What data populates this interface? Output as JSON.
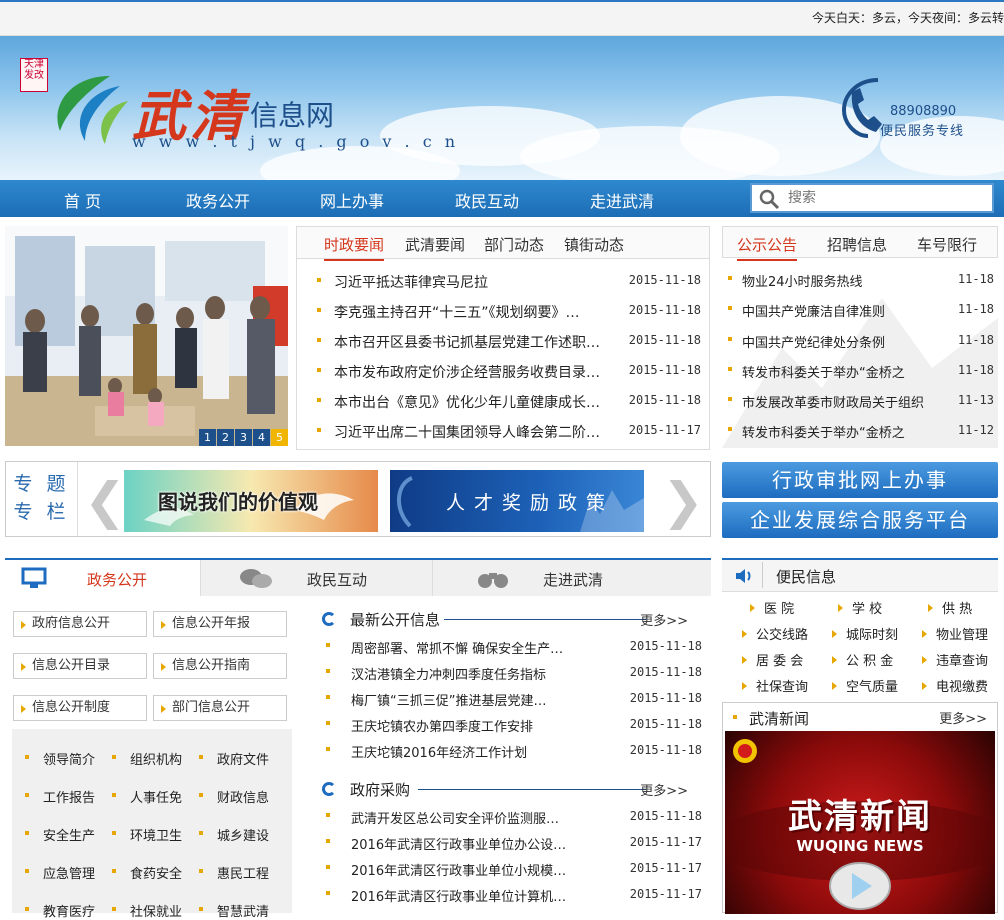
{
  "weather": "今天白天：多云，今天夜间：多云转",
  "header": {
    "emblem_text": "天津发改",
    "logo_title": "武清",
    "logo_sub": "信息网",
    "logo_url": "w w w . t j w q . g o v . c n",
    "hotline_number": "88908890",
    "hotline_text": "便民服务专线"
  },
  "nav": {
    "items": [
      "首 页",
      "政务公开",
      "网上办事",
      "政民互动",
      "走进武清"
    ],
    "search_placeholder": "搜索"
  },
  "slideshow": {
    "pages": [
      "1",
      "2",
      "3",
      "4",
      "5"
    ],
    "active_page": "5"
  },
  "news": {
    "tabs": [
      "时政要闻",
      "武清要闻",
      "部门动态",
      "镇街动态"
    ],
    "items": [
      {
        "title": "习近平抵达菲律宾马尼拉",
        "date": "2015-11-18"
      },
      {
        "title": "李克强主持召开“十三五”《规划纲要》…",
        "date": "2015-11-18"
      },
      {
        "title": "本市召开区县委书记抓基层党建工作述职…",
        "date": "2015-11-18"
      },
      {
        "title": "本市发布政府定价涉企经营服务收费目录…",
        "date": "2015-11-18"
      },
      {
        "title": "本市出台《意见》优化少年儿童健康成长…",
        "date": "2015-11-18"
      },
      {
        "title": "习近平出席二十国集团领导人峰会第二阶…",
        "date": "2015-11-17"
      }
    ]
  },
  "notice": {
    "tabs": [
      "公示公告",
      "招聘信息",
      "车号限行"
    ],
    "items": [
      {
        "title": "物业24小时服务热线",
        "date": "11-18"
      },
      {
        "title": "中国共产党廉洁自律准则",
        "date": "11-18"
      },
      {
        "title": "中国共产党纪律处分条例",
        "date": "11-18"
      },
      {
        "title": "转发市科委关于举办“金桥之",
        "date": "11-18"
      },
      {
        "title": "市发展改革委市财政局关于组织",
        "date": "11-13"
      },
      {
        "title": "转发市科委关于举办“金桥之",
        "date": "11-12"
      }
    ]
  },
  "topics": {
    "label_line1": "专 题",
    "label_line2": "专 栏",
    "banner1": "图说我们的价值观",
    "banner2": "人才奖励政策"
  },
  "big_buttons": [
    "行政审批网上办事",
    "企业发展综合服务平台"
  ],
  "lower_tabs": [
    "政务公开",
    "政民互动",
    "走进武清"
  ],
  "affairs_buttons": [
    "政府信息公开",
    "信息公开年报",
    "信息公开目录",
    "信息公开指南",
    "信息公开制度",
    "部门信息公开"
  ],
  "affairs_links": [
    [
      "领导简介",
      "组织机构",
      "政府文件"
    ],
    [
      "工作报告",
      "人事任免",
      "财政信息"
    ],
    [
      "安全生产",
      "环境卫生",
      "城乡建设"
    ],
    [
      "应急管理",
      "食药安全",
      "惠民工程"
    ],
    [
      "教育医疗",
      "社保就业",
      "智慧武清"
    ]
  ],
  "open_info": {
    "title": "最新公开信息",
    "more": "更多>>",
    "items": [
      {
        "title": "周密部署、常抓不懈 确保安全生产…",
        "date": "2015-11-18"
      },
      {
        "title": "汊沽港镇全力冲刺四季度任务指标",
        "date": "2015-11-18"
      },
      {
        "title": "梅厂镇“三抓三促”推进基层党建…",
        "date": "2015-11-18"
      },
      {
        "title": "王庆坨镇农办第四季度工作安排",
        "date": "2015-11-18"
      },
      {
        "title": "王庆坨镇2016年经济工作计划",
        "date": "2015-11-18"
      }
    ]
  },
  "procurement": {
    "title": "政府采购",
    "more": "更多>>",
    "items": [
      {
        "title": "武清开发区总公司安全评价监测服…",
        "date": "2015-11-18"
      },
      {
        "title": "2016年武清区行政事业单位办公设…",
        "date": "2015-11-17"
      },
      {
        "title": "2016年武清区行政事业单位小规模…",
        "date": "2015-11-17"
      },
      {
        "title": "2016年武清区行政事业单位计算机…",
        "date": "2015-11-17"
      }
    ]
  },
  "convenience": {
    "title": "便民信息",
    "items": [
      [
        "医 院",
        "学 校",
        "供 热"
      ],
      [
        "公交线路",
        "城际时刻",
        "物业管理"
      ],
      [
        "居 委 会",
        "公 积 金",
        "违章查询"
      ],
      [
        "社保查询",
        "空气质量",
        "电视缴费"
      ]
    ]
  },
  "wq_news": {
    "title": "武清新闻",
    "more": "更多>>",
    "video_title": "武清新闻",
    "video_sub": "WUQING NEWS"
  },
  "colors": {
    "brand_blue": "#1d6cc0",
    "accent_red": "#d4371c",
    "bullet_gold": "#e6a800"
  }
}
